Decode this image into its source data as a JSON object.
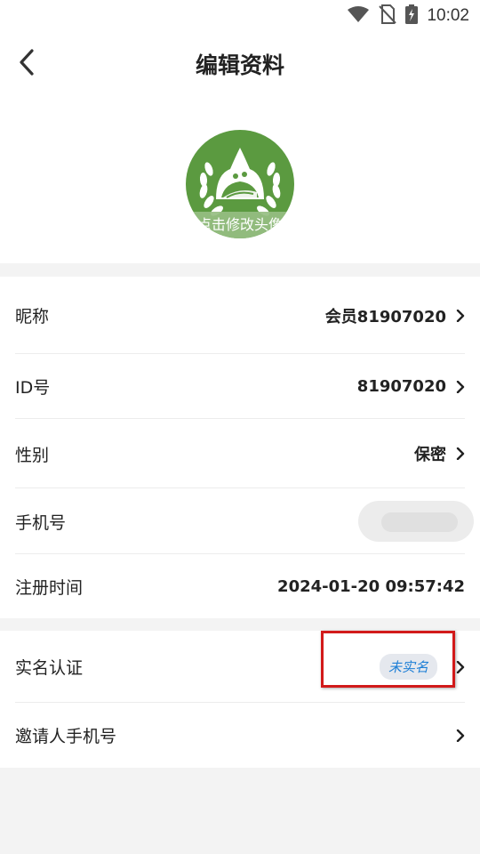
{
  "status_bar": {
    "time": "10:02",
    "icons": [
      "wifi-icon",
      "no-sim-icon",
      "battery-charging-icon"
    ]
  },
  "app_bar": {
    "title": "编辑资料",
    "back_icon": "back-arrow-icon"
  },
  "avatar": {
    "caption": "点击修改头像",
    "background_color": "#5b9a40"
  },
  "profile_rows": [
    {
      "label": "昵称",
      "value": "会员81907020",
      "chevron": true
    },
    {
      "label": "ID号",
      "value": "81907020",
      "chevron": true
    },
    {
      "label": "性别",
      "value": "保密",
      "chevron": true
    },
    {
      "label": "手机号",
      "value": "",
      "chevron": false
    },
    {
      "label": "注册时间",
      "value": "2024-01-20 09:57:42",
      "chevron": false
    }
  ],
  "verification_rows": [
    {
      "label": "实名认证",
      "badge": "未实名",
      "chevron": true
    },
    {
      "label": "邀请人手机号",
      "value": "",
      "chevron": true
    }
  ],
  "colors": {
    "badge_text": "#1e7fd6",
    "highlight_border": "#d21a1a",
    "page_background": "#f3f3f3"
  }
}
